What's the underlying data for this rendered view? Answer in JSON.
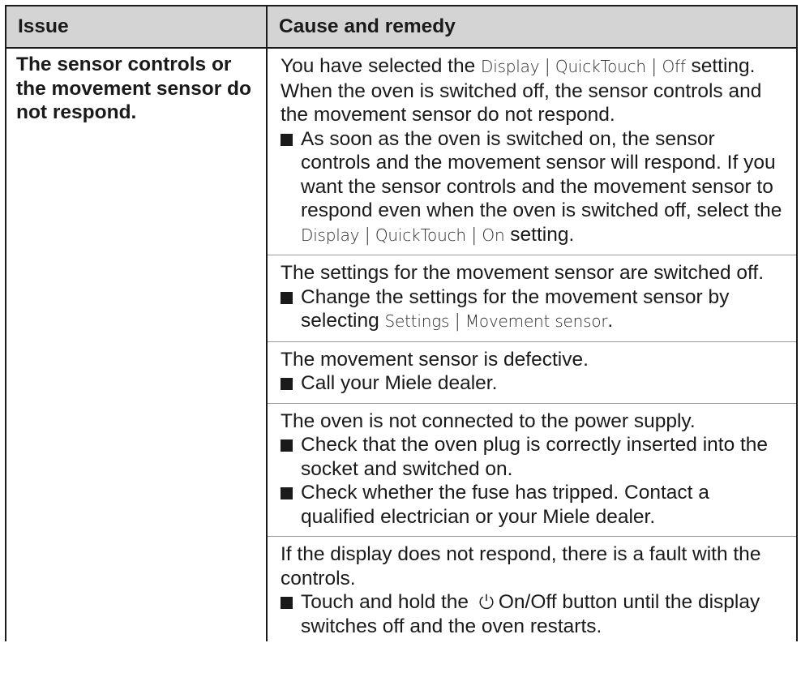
{
  "table": {
    "headers": {
      "issue": "Issue",
      "cause": "Cause and remedy"
    },
    "issue": "The sensor controls or the movement sensor do not respond.",
    "rows": {
      "r1": {
        "cause_a": "You have selected the ",
        "menu1": "Display",
        "menu2": "QuickTouch",
        "menu3": "Off",
        "cause_b": " setting. When the oven is switched off, the sensor controls and the movement sensor do not respond.",
        "remedy_a": "As soon as the oven is switched on, the sensor controls and the movement sensor will respond. If you want the sensor controls and the movement sensor to respond even when the oven is switched off, select the ",
        "rmenu1": "Display",
        "rmenu2": "QuickTouch",
        "rmenu3": "On",
        "remedy_b": " setting."
      },
      "r2": {
        "cause": "The settings for the movement sensor are switched off.",
        "remedy_a": "Change the settings for the movement sensor by selecting ",
        "rmenu1": "Settings",
        "rmenu2": "Movement sensor",
        "remedy_b": "."
      },
      "r3": {
        "cause": "The movement sensor is defective.",
        "remedy": "Call your Miele dealer."
      },
      "r4": {
        "cause": "The oven is not connected to the power supply.",
        "remedy1": "Check that the oven plug is correctly inserted into the socket and switched on.",
        "remedy2": "Check whether the fuse has tripped. Contact a qualified electrician or your Miele dealer."
      },
      "r5": {
        "cause": "If the display does not respond, there is a fault with the controls.",
        "remedy_a": "Touch and hold the ",
        "remedy_b": "On/Off button until the display switches off and the oven restarts.",
        "icon": "power-icon"
      }
    },
    "menu_separator": "|"
  }
}
